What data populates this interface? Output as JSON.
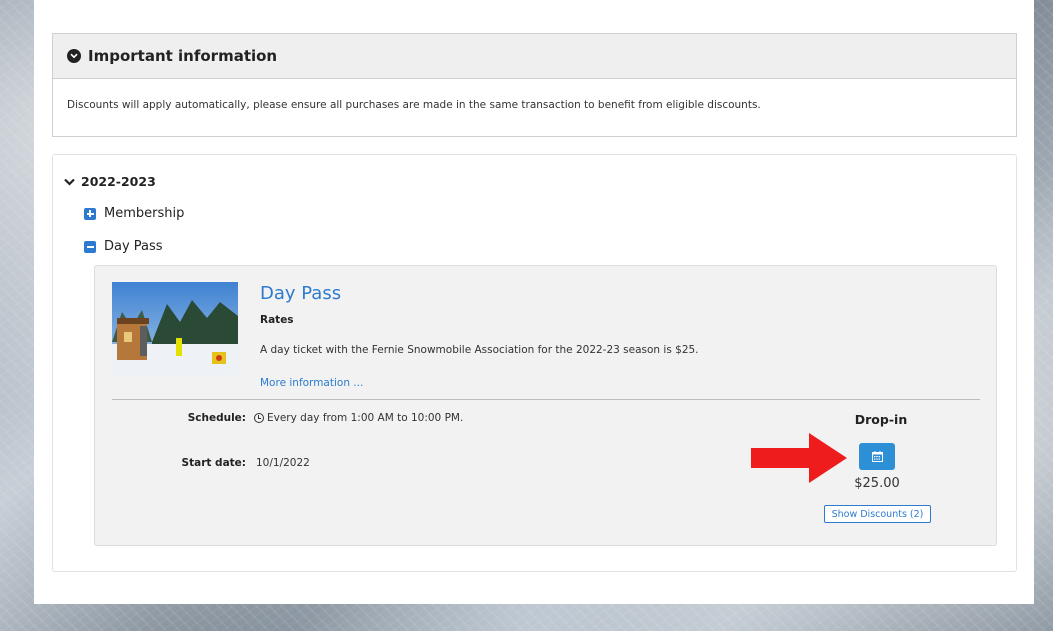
{
  "info": {
    "title": "Important information",
    "body": "Discounts will apply automatically, please ensure all purchases are made in the same transaction to benefit from eligible discounts."
  },
  "season": {
    "title": "2022-2023",
    "categories": [
      {
        "label": "Membership",
        "expanded": false
      },
      {
        "label": "Day Pass",
        "expanded": true
      }
    ]
  },
  "product": {
    "title": "Day Pass",
    "rates_label": "Rates",
    "description": "A day ticket with the Fernie Snowmobile Association for the 2022-23 season is $25.",
    "more_link": "More information ...",
    "schedule_label": "Schedule:",
    "schedule_value": "Every day from 1:00 AM to 10:00 PM.",
    "start_label": "Start date:",
    "start_value": "10/1/2022",
    "dropin_label": "Drop-in",
    "price": "$25.00",
    "discounts_button": "Show Discounts (2)"
  },
  "colors": {
    "accent": "#2d7bd0",
    "button": "#2d8fd6",
    "arrow": "#ee1c1c"
  },
  "icons": [
    "circle-chevron-down-icon",
    "chevron-down-icon",
    "plus-square-icon",
    "minus-square-icon",
    "clock-icon",
    "calendar-icon",
    "red-arrow-annotation"
  ]
}
